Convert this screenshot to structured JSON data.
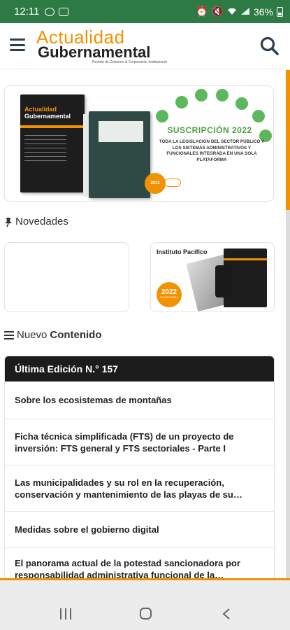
{
  "status_bar": {
    "time": "12:11",
    "battery": "36%",
    "left_icons": [
      "whatsapp-icon",
      "cast-icon"
    ],
    "right_icons": [
      "alarm-icon",
      "mute-icon",
      "wifi-icon",
      "signal-icon",
      "battery-icon"
    ]
  },
  "header": {
    "logo_top": "Actualidad",
    "logo_bottom": "Gubernamental",
    "logo_tagline": "Revista de Gobierno & Corporación Institucional"
  },
  "banner": {
    "book1_title_a": "Actualidad",
    "book1_title_b": "Gubernamental",
    "title": "SUSCRIPCIÓN 2022",
    "text": "TODA LA LEGISLACIÓN DEL SECTOR PÚBLICO Y LOS SISTEMAS ADMINISTRATIVOS Y FUNCIONALES INTEGRADA EN UNA SOLA PLATAFORMA",
    "badge": "2022"
  },
  "novedades": {
    "label": "Novedades",
    "promo_logo": "Instituto Pacífico",
    "promo_badge": "2022",
    "promo_badge_sub": "YA DISPONIBLE"
  },
  "nuevo_contenido": {
    "label_a": "Nuevo",
    "label_b": "Contenido"
  },
  "news": {
    "header": "Última Edición N.° 157",
    "items": [
      {
        "title": "Sobre los ecosistemas de montañas"
      },
      {
        "title": "Ficha técnica simplificada (FTS) de un proyecto de inversión: FTS general y FTS sectoriales - Parte I"
      },
      {
        "title": "Las municipalidades y su rol en la recuperación, conservación y mantenimiento de las playas de su ámbito..."
      },
      {
        "title": "Medidas sobre el gobierno digital"
      },
      {
        "title": "El panorama actual de la potestad sancionadora por responsabilidad administrativa funcional de la Contraloría..."
      }
    ]
  },
  "colors": {
    "status_bar": "#2e7a45",
    "accent": "#f39200",
    "news_header": "#1c1c1c"
  }
}
